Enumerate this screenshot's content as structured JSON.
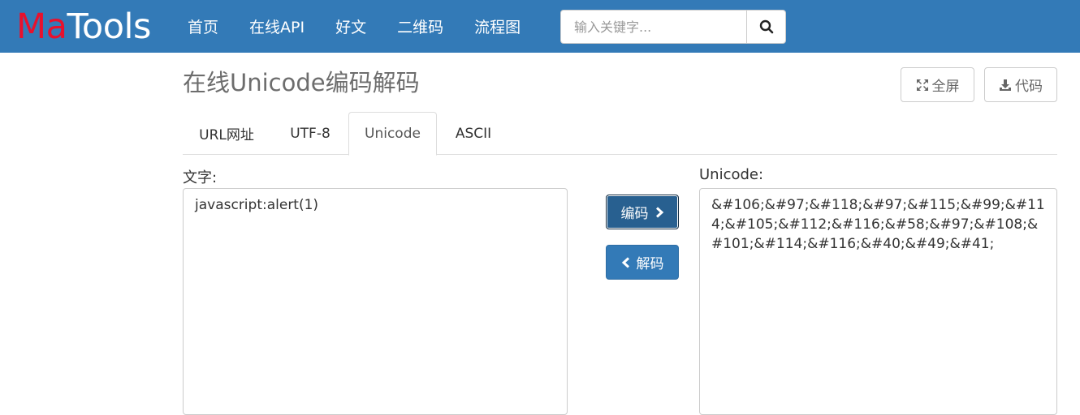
{
  "header": {
    "brand_ma": "Ma",
    "brand_tools": "Tools",
    "nav": [
      "首页",
      "在线API",
      "好文",
      "二维码",
      "流程图"
    ],
    "search_placeholder": "输入关键字..."
  },
  "page": {
    "title": "在线Unicode编码解码",
    "fullscreen_label": "全屏",
    "code_label": "代码"
  },
  "tabs": [
    "URL网址",
    "UTF-8",
    "Unicode",
    "ASCII"
  ],
  "active_tab": "Unicode",
  "converter": {
    "input_label": "文字:",
    "output_label": "Unicode:",
    "input_value": "javascript:alert(1)",
    "output_value": "&#106;&#97;&#118;&#97;&#115;&#99;&#114;&#105;&#112;&#116;&#58;&#97;&#108;&#101;&#114;&#116;&#40;&#49;&#41;",
    "encode_label": "编码",
    "decode_label": "解码"
  },
  "colors": {
    "navbar": "#337ab7",
    "brand_ma": "#e8112d",
    "primary_button": "#337ab7",
    "pressed_button": "#286090"
  },
  "icons": [
    "search-icon",
    "expand-icon",
    "download-icon",
    "chevron-right-icon",
    "chevron-left-icon"
  ]
}
